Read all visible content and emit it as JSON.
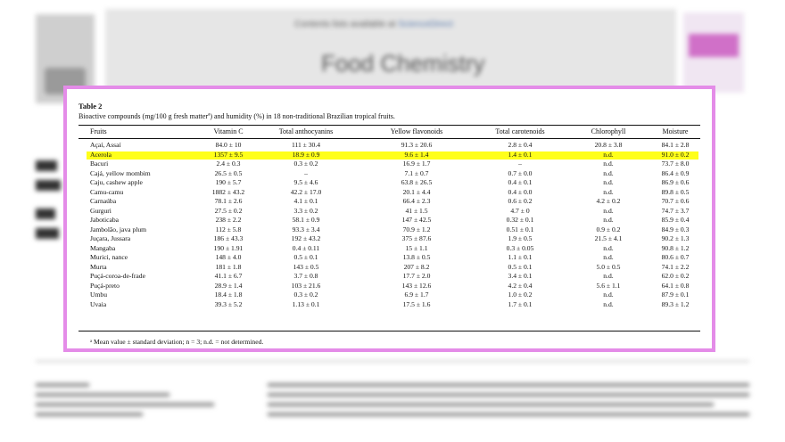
{
  "background": {
    "contents_text": "Contents lists available at",
    "contents_link": "ScienceDirect",
    "journal_title": "Food Chemistry"
  },
  "table": {
    "label": "Table 2",
    "caption": "Bioactive compounds (mg/100 g fresh matter",
    "caption_sup": "a",
    "caption_rest": ") and humidity (%) in 18 non-traditional Brazilian tropical fruits.",
    "highlight_color": "#ffff1a",
    "columns": [
      "Fruits",
      "Vitamin C",
      "Total anthocyanins",
      "Yellow flavonoids",
      "Total carotenoids",
      "Chlorophyll",
      "Moisture"
    ],
    "rows": [
      {
        "fruit": "Açaí, Assaí",
        "vitc": "84.0 ± 10",
        "anth": "111 ± 30.4",
        "flav": "91.3 ± 20.6",
        "carot": "2.8 ± 0.4",
        "chlor": "20.8 ± 3.8",
        "moist": "84.1 ± 2.8",
        "highlight": false
      },
      {
        "fruit": "Acerola",
        "vitc": "1357 ± 9.5",
        "anth": "18.9 ± 0.9",
        "flav": "9.6 ± 1.4",
        "carot": "1.4 ± 0.1",
        "chlor": "n.d.",
        "moist": "91.0 ± 0.2",
        "highlight": true
      },
      {
        "fruit": "Bacuri",
        "vitc": "2.4 ± 0.3",
        "anth": "0.3 ± 0.2",
        "flav": "16.9 ± 1.7",
        "carot": "–",
        "chlor": "n.d.",
        "moist": "73.7 ± 8.0",
        "highlight": false
      },
      {
        "fruit": "Cajá, yellow mombim",
        "vitc": "26.5 ± 0.5",
        "anth": "–",
        "flav": "7.1 ± 0.7",
        "carot": "0.7 ± 0.0",
        "chlor": "n.d.",
        "moist": "86.4 ± 0.9",
        "highlight": false
      },
      {
        "fruit": "Caju, cashew apple",
        "vitc": "190 ± 5.7",
        "anth": "9.5 ± 4.6",
        "flav": "63.8 ± 26.5",
        "carot": "0.4 ± 0.1",
        "chlor": "n.d.",
        "moist": "86.9 ± 0.6",
        "highlight": false
      },
      {
        "fruit": "Camu-camu",
        "vitc": "1882 ± 43.2",
        "anth": "42.2 ± 17.0",
        "flav": "20.1 ± 4.4",
        "carot": "0.4 ± 0.0",
        "chlor": "n.d.",
        "moist": "89.8 ± 0.5",
        "highlight": false
      },
      {
        "fruit": "Carnaúba",
        "vitc": "78.1 ± 2.6",
        "anth": "4.1 ± 0.1",
        "flav": "66.4 ± 2.3",
        "carot": "0.6 ± 0.2",
        "chlor": "4.2 ± 0.2",
        "moist": "70.7 ± 0.6",
        "highlight": false
      },
      {
        "fruit": "Gurguri",
        "vitc": "27.5 ± 0.2",
        "anth": "3.3 ± 0.2",
        "flav": "41 ± 1.5",
        "carot": "4.7 ± 0",
        "chlor": "n.d.",
        "moist": "74.7 ± 3.7",
        "highlight": false
      },
      {
        "fruit": "Jaboticaba",
        "vitc": "238 ± 2.2",
        "anth": "58.1 ± 0.9",
        "flav": "147 ± 42.5",
        "carot": "0.32 ± 0.1",
        "chlor": "n.d.",
        "moist": "85.9 ± 0.4",
        "highlight": false
      },
      {
        "fruit": "Jambolão, java plum",
        "vitc": "112 ± 5.8",
        "anth": "93.3 ± 3.4",
        "flav": "70.9 ± 1.2",
        "carot": "0.51 ± 0.1",
        "chlor": "0.9 ± 0.2",
        "moist": "84.9 ± 0.3",
        "highlight": false
      },
      {
        "fruit": "Juçara, Jussara",
        "vitc": "186 ± 43.3",
        "anth": "192 ± 43.2",
        "flav": "375 ± 87.6",
        "carot": "1.9 ± 0.5",
        "chlor": "21.5 ± 4.1",
        "moist": "90.2 ± 1.3",
        "highlight": false
      },
      {
        "fruit": "Mangaba",
        "vitc": "190 ± 1.91",
        "anth": "0.4 ± 0.11",
        "flav": "15 ± 1.1",
        "carot": "0.3 ± 0.05",
        "chlor": "n.d.",
        "moist": "90.8 ± 1.2",
        "highlight": false
      },
      {
        "fruit": "Murici, nance",
        "vitc": "148 ± 4.0",
        "anth": "0.5 ± 0.1",
        "flav": "13.8 ± 0.5",
        "carot": "1.1 ± 0.1",
        "chlor": "n.d.",
        "moist": "80.6 ± 0.7",
        "highlight": false
      },
      {
        "fruit": "Murta",
        "vitc": "181 ± 1.8",
        "anth": "143 ± 0.5",
        "flav": "207 ± 8.2",
        "carot": "0.5 ± 0.1",
        "chlor": "5.0 ± 0.5",
        "moist": "74.1 ± 2.2",
        "highlight": false
      },
      {
        "fruit": "Puçá-coroa-de-frade",
        "vitc": "41.1 ± 6.7",
        "anth": "3.7 ± 0.8",
        "flav": "17.7 ± 2.0",
        "carot": "3.4 ± 0.1",
        "chlor": "n.d.",
        "moist": "62.0 ± 0.2",
        "highlight": false
      },
      {
        "fruit": "Puçá-preto",
        "vitc": "28.9 ± 1.4",
        "anth": "103 ± 21.6",
        "flav": "143 ± 12.6",
        "carot": "4.2 ± 0.4",
        "chlor": "5.6 ± 1.1",
        "moist": "64.1 ± 0.8",
        "highlight": false
      },
      {
        "fruit": "Umbu",
        "vitc": "18.4 ± 1.8",
        "anth": "0.3 ± 0.2",
        "flav": "6.9 ± 1.7",
        "carot": "1.0 ± 0.2",
        "chlor": "n.d.",
        "moist": "87.9 ± 0.1",
        "highlight": false
      },
      {
        "fruit": "Uvaia",
        "vitc": "39.3 ± 5.2",
        "anth": "1.13 ± 0.1",
        "flav": "17.5 ± 1.6",
        "carot": "1.7 ± 0.1",
        "chlor": "n.d.",
        "moist": "89.3 ± 1.2",
        "highlight": false
      }
    ],
    "footnote": "ᵃ  Mean value ± standard deviation; n = 3; n.d. = not determined."
  }
}
